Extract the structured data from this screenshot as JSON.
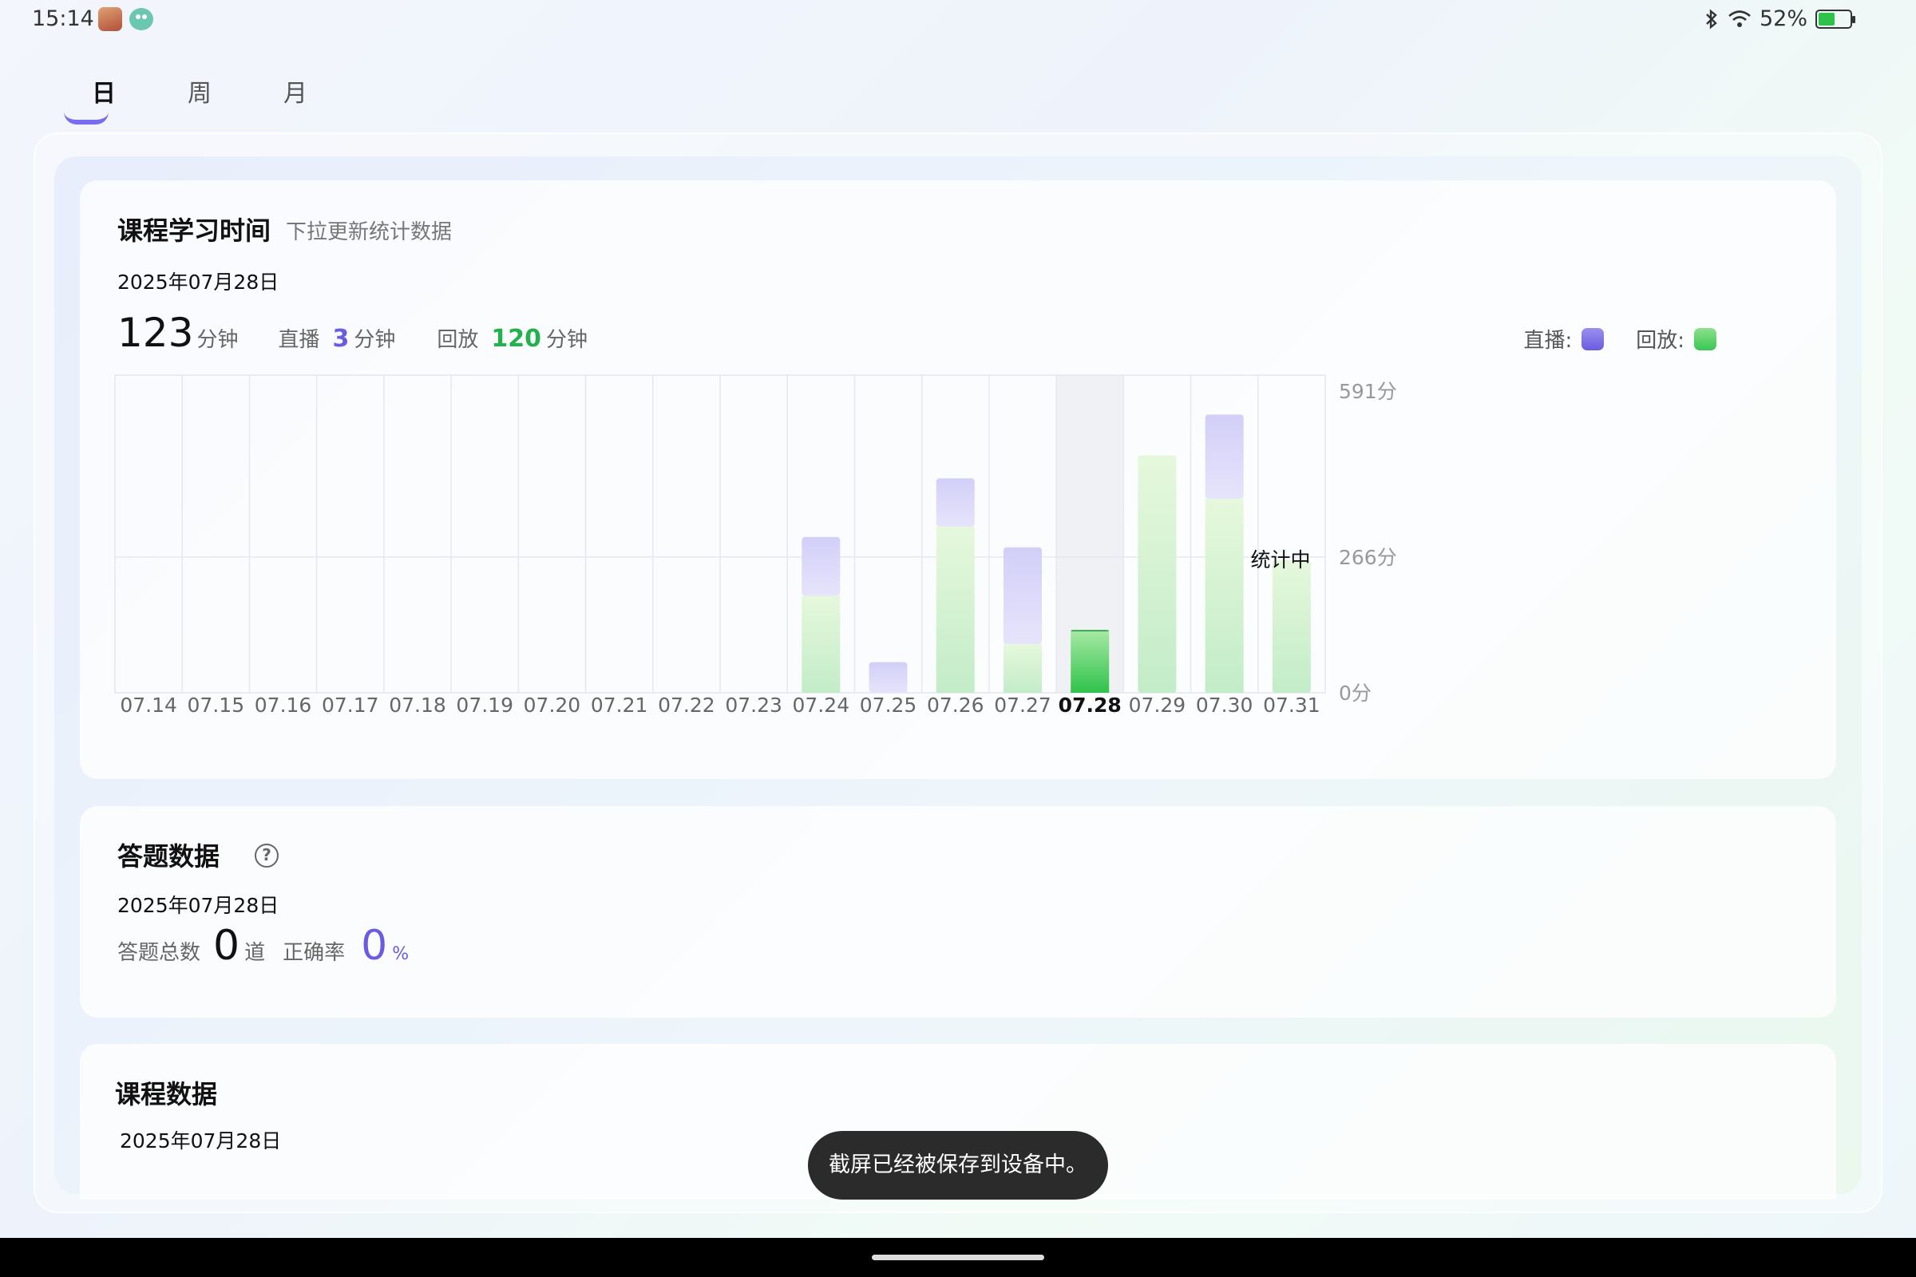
{
  "status_bar": {
    "time": "15:14",
    "battery": "52%",
    "battery_level": 0.52,
    "bluetooth_icon": "bluetooth-icon",
    "wifi_icon": "wifi-icon"
  },
  "tabs": [
    {
      "label": "日",
      "active": true
    },
    {
      "label": "周",
      "active": false
    },
    {
      "label": "月",
      "active": false
    }
  ],
  "study_card": {
    "title": "课程学习时间",
    "subtitle": "下拉更新统计数据",
    "date": "2025年07月28日",
    "total": "123",
    "total_unit": "分钟",
    "live_label": "直播",
    "live_value": "3",
    "live_unit": "分钟",
    "replay_label": "回放",
    "replay_value": "120",
    "replay_unit": "分钟",
    "legend_live": "直播:",
    "legend_replay": "回放:",
    "status_label": "统计中"
  },
  "chart_data": {
    "type": "bar",
    "stacked": true,
    "categories": [
      "07.14",
      "07.15",
      "07.16",
      "07.17",
      "07.18",
      "07.19",
      "07.20",
      "07.21",
      "07.22",
      "07.23",
      "07.24",
      "07.25",
      "07.26",
      "07.27",
      "07.28",
      "07.29",
      "07.30",
      "07.31"
    ],
    "series": [
      {
        "name": "回放",
        "color": "#8fe0a0",
        "values": [
          0,
          0,
          0,
          0,
          0,
          0,
          0,
          0,
          0,
          0,
          190,
          0,
          325,
          95,
          120,
          465,
          380,
          260
        ]
      },
      {
        "name": "直播",
        "color": "#c8c6f6",
        "values": [
          0,
          0,
          0,
          0,
          0,
          0,
          0,
          0,
          0,
          0,
          115,
          60,
          95,
          190,
          3,
          0,
          165,
          0
        ]
      }
    ],
    "y_ticks": [
      "591分",
      "266分",
      "0分"
    ],
    "ylim": [
      0,
      591
    ],
    "selected_index": 14,
    "selected_color": "#2fc24b",
    "grid": true
  },
  "answer_card": {
    "title": "答题数据",
    "date": "2025年07月28日",
    "total_label": "答题总数",
    "total_value": "0",
    "total_unit": "道",
    "rate_label": "正确率",
    "rate_value": "0",
    "rate_unit": "%"
  },
  "course_card": {
    "title": "课程数据",
    "date": "2025年07月28日"
  },
  "toast": {
    "text": "截屏已经被保存到设备中。"
  }
}
